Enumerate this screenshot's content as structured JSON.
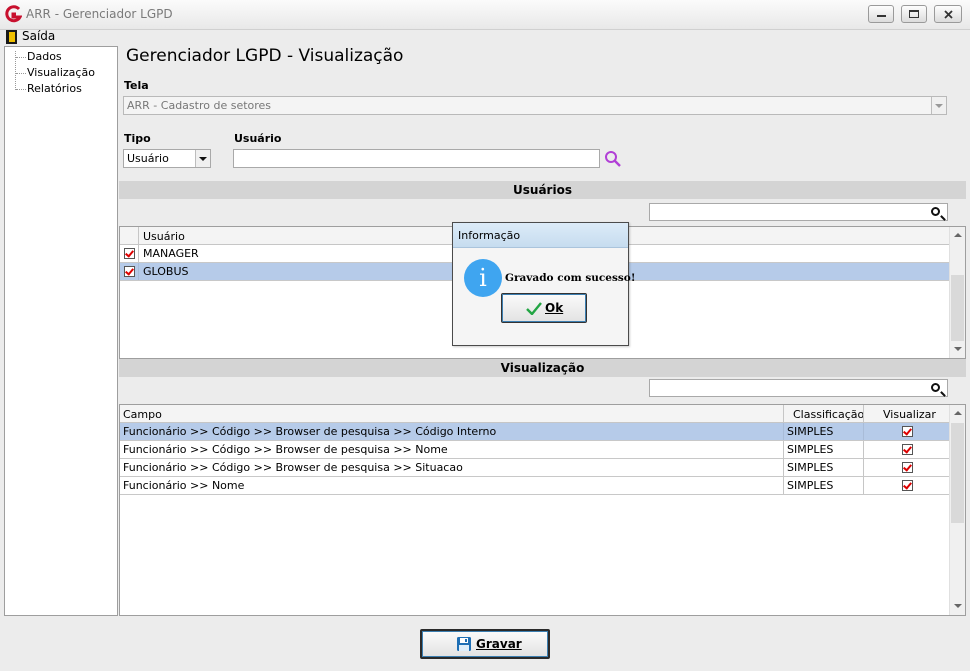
{
  "window": {
    "title": "ARR - Gerenciador LGPD",
    "logo_letter": "G",
    "controls": {
      "minimize": "▭",
      "restore": "▣",
      "close": "✕"
    }
  },
  "menu": {
    "exit_label": "Saída",
    "exit_icon": "exit-door-icon"
  },
  "sidebar": {
    "items": [
      {
        "label": "Dados"
      },
      {
        "label": "Visualização"
      },
      {
        "label": "Relatórios"
      }
    ]
  },
  "page": {
    "title": "Gerenciador LGPD - Visualização",
    "tela_label": "Tela",
    "tela_value": "ARR - Cadastro de setores",
    "tipo_label": "Tipo",
    "tipo_value": "Usuário",
    "usuario_label": "Usuário",
    "usuario_value": ""
  },
  "users_section": {
    "title": "Usuários",
    "search_value": "",
    "column_header": "Usuário",
    "rows": [
      {
        "name": "MANAGER",
        "checked": true,
        "selected": false
      },
      {
        "name": "GLOBUS",
        "checked": true,
        "selected": true
      }
    ]
  },
  "view_section": {
    "title": "Visualização",
    "search_value": "",
    "columns": {
      "campo": "Campo",
      "classificacao": "Classificação",
      "visualizar": "Visualizar"
    },
    "rows": [
      {
        "campo": "Funcionário >> Código >> Browser de pesquisa >> Código Interno",
        "classificacao": "SIMPLES",
        "visualizar": true,
        "selected": true
      },
      {
        "campo": "Funcionário >> Código >> Browser de pesquisa >> Nome",
        "classificacao": "SIMPLES",
        "visualizar": true,
        "selected": false
      },
      {
        "campo": "Funcionário >> Código >> Browser de pesquisa >> Situacao",
        "classificacao": "SIMPLES",
        "visualizar": true,
        "selected": false
      },
      {
        "campo": "Funcionário >> Nome",
        "classificacao": "SIMPLES",
        "visualizar": true,
        "selected": false
      }
    ]
  },
  "dialog": {
    "title": "Informação",
    "message": "Gravado com sucesso!",
    "icon_glyph": "i",
    "ok_label": "Ok"
  },
  "footer": {
    "save_label": "Gravar"
  },
  "colors": {
    "selection": "#b6cbe9",
    "info_blue": "#3fa5f0",
    "search_purple": "#b13fd6",
    "check_red": "#d00000"
  }
}
